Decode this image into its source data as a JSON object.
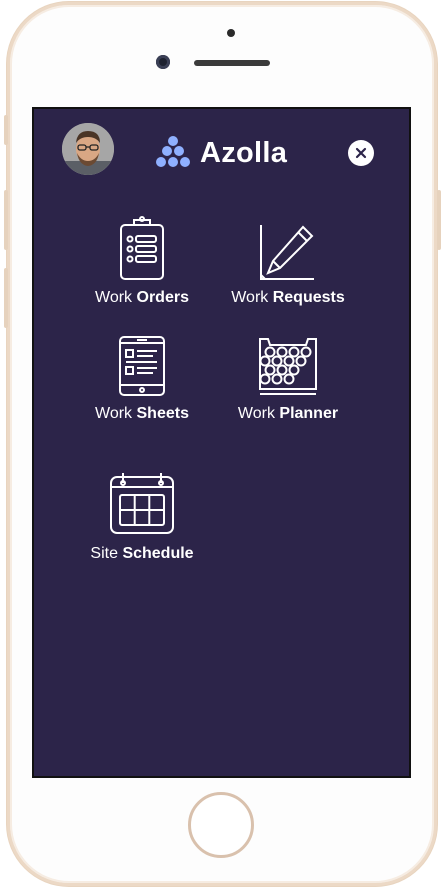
{
  "app": {
    "brand_name": "Azolla",
    "brand_color": "#8fb0ff",
    "screen_bg": "#2c2449"
  },
  "header": {
    "avatar": "user-avatar",
    "close_icon": "close-icon"
  },
  "menu": [
    {
      "prefix": "Work ",
      "bold": "Orders",
      "icon": "clipboard-list-icon"
    },
    {
      "prefix": "Work ",
      "bold": "Requests",
      "icon": "pencil-icon"
    },
    {
      "prefix": "Work ",
      "bold": "Sheets",
      "icon": "tablet-list-icon"
    },
    {
      "prefix": "Work ",
      "bold": "Planner",
      "icon": "planner-grid-icon"
    },
    {
      "prefix": "Site ",
      "bold": "Schedule",
      "icon": "calendar-icon"
    }
  ]
}
